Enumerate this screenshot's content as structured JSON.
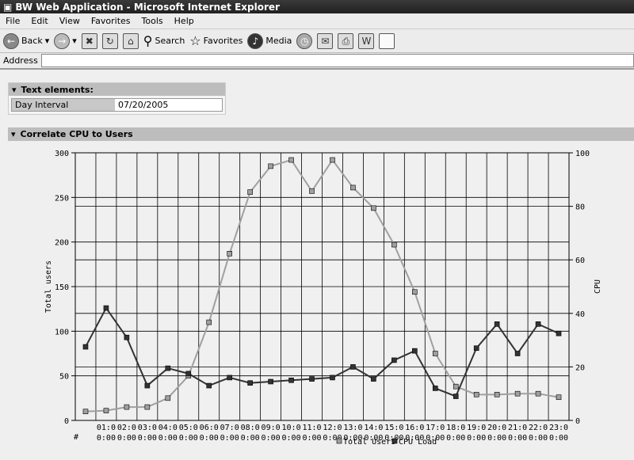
{
  "window": {
    "title": "BW Web Application - Microsoft Internet Explorer"
  },
  "menu": [
    "File",
    "Edit",
    "View",
    "Favorites",
    "Tools",
    "Help"
  ],
  "toolbar": {
    "back": "Back",
    "search": "Search",
    "favorites": "Favorites",
    "media": "Media"
  },
  "address": {
    "label": "Address",
    "value": ""
  },
  "text_elements": {
    "title": "Text elements:",
    "rows": [
      {
        "label": "Day Interval",
        "value": "07/20/2005"
      }
    ]
  },
  "chart_section": {
    "title": "Correlate CPU to Users"
  },
  "chart_data": {
    "type": "line",
    "categories": [
      "#",
      "01:00:00",
      "02:00:00",
      "03:00:00",
      "04:00:00",
      "05:00:00",
      "06:00:00",
      "07:00:00",
      "08:00:00",
      "09:00:00",
      "10:00:00",
      "11:00:00",
      "12:00:00",
      "13:00:00",
      "14:00:00",
      "15:00:00",
      "16:00:00",
      "17:00:00",
      "18:00:00",
      "19:00:00",
      "20:00:00",
      "21:00:00",
      "22:00:00",
      "23:00:00"
    ],
    "ylabel": "Total users",
    "y2label": "CPU",
    "ylim": [
      0,
      300
    ],
    "yticks": [
      0,
      50,
      100,
      150,
      200,
      250,
      300
    ],
    "y2lim": [
      0,
      100
    ],
    "y2ticks": [
      0,
      20,
      40,
      60,
      80,
      100
    ],
    "grid": true,
    "legend_position": "bottom",
    "series": [
      {
        "name": "Total Users",
        "axis": "left",
        "color": "#a0a0a0",
        "values": [
          10,
          11,
          15,
          15,
          25,
          50,
          110,
          187,
          256,
          285,
          292,
          257,
          292,
          261,
          238,
          197,
          144,
          75,
          38,
          29,
          29,
          30,
          30,
          26
        ]
      },
      {
        "name": "CPU Load",
        "axis": "right",
        "color": "#333333",
        "values": [
          27.5,
          42,
          31,
          13,
          19.5,
          17.5,
          13,
          16,
          14,
          14.5,
          15,
          15.5,
          16,
          20,
          15.5,
          22.5,
          26,
          12,
          9,
          27,
          36,
          25,
          36,
          32.5
        ]
      }
    ]
  }
}
